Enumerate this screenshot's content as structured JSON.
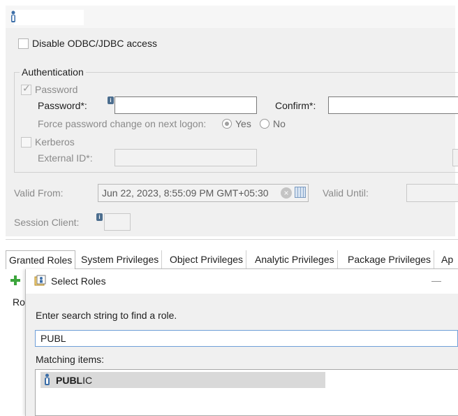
{
  "user_form": {
    "disable_odbc_label": "Disable ODBC/JDBC access",
    "authentication": {
      "group_title": "Authentication",
      "password_checkbox_label": "Password",
      "password_label": "Password*:",
      "confirm_label": "Confirm*:",
      "force_change_label": "Force password change on next logon:",
      "yes_label": "Yes",
      "no_label": "No",
      "kerberos_label": "Kerberos",
      "external_id_label": "External ID*:"
    },
    "valid_from_label": "Valid From:",
    "valid_from_value": "Jun 22, 2023, 8:55:09 PM GMT+05:30",
    "valid_until_label": "Valid Until:",
    "session_client_label": "Session Client:"
  },
  "tabs": [
    {
      "label": "Granted Roles"
    },
    {
      "label": "System Privileges"
    },
    {
      "label": "Object Privileges"
    },
    {
      "label": "Analytic Privileges"
    },
    {
      "label": "Package Privileges"
    },
    {
      "label": "Ap"
    }
  ],
  "roles_list_header_fragment": "Ro",
  "dialog": {
    "title": "Select Roles",
    "minimize_glyph": "—",
    "prompt": "Enter search string to find a role.",
    "search_value": "PUBL",
    "matching_label": "Matching items:",
    "items": [
      {
        "match": "PUBL",
        "rest": "IC"
      }
    ]
  },
  "colors": {
    "panel_bg": "#f0f0f0",
    "focus_border": "#6f9fd8",
    "selection_bg": "#d9d9d9",
    "add_icon_green": "#3ca53c"
  },
  "icons": {
    "user": "user-icon",
    "info": "info-icon",
    "add": "add-icon",
    "dialog": "select-roles-icon",
    "role": "role-icon",
    "clear": "clear-icon",
    "calendar": "calendar-icon"
  }
}
